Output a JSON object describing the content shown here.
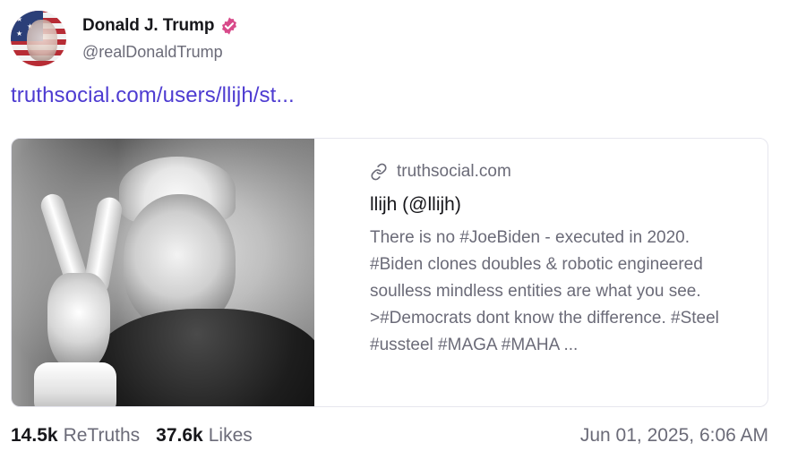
{
  "author": {
    "display_name": "Donald J. Trump",
    "handle": "@realDonaldTrump",
    "avatar_icon": "american-flag-portrait-avatar",
    "verified_icon": "verified-badge-icon",
    "verified_color": "#d84a8a"
  },
  "post": {
    "link_text": "truthsocial.com/users/llijh/st..."
  },
  "link_card": {
    "image_icon": "peace-sign-portrait-photo",
    "domain_icon": "link-icon",
    "domain": "truthsocial.com",
    "title": "llijh (@llijh)",
    "description": "There is no #JoeBiden - executed in 2020. #Biden clones doubles & robotic engineered soulless mindless entities are what you see. >#Democrats dont know the difference. #Steel #ussteel #MAGA #MAHA ..."
  },
  "stats": {
    "retruths_count": "14.5k",
    "retruths_label": "ReTruths",
    "likes_count": "37.6k",
    "likes_label": "Likes"
  },
  "timestamp": "Jun 01, 2025, 6:06 AM",
  "colors": {
    "link": "#4d3bd1",
    "muted_text": "#6b6b78",
    "primary_text": "#16161a",
    "border": "#e6e6ee"
  }
}
